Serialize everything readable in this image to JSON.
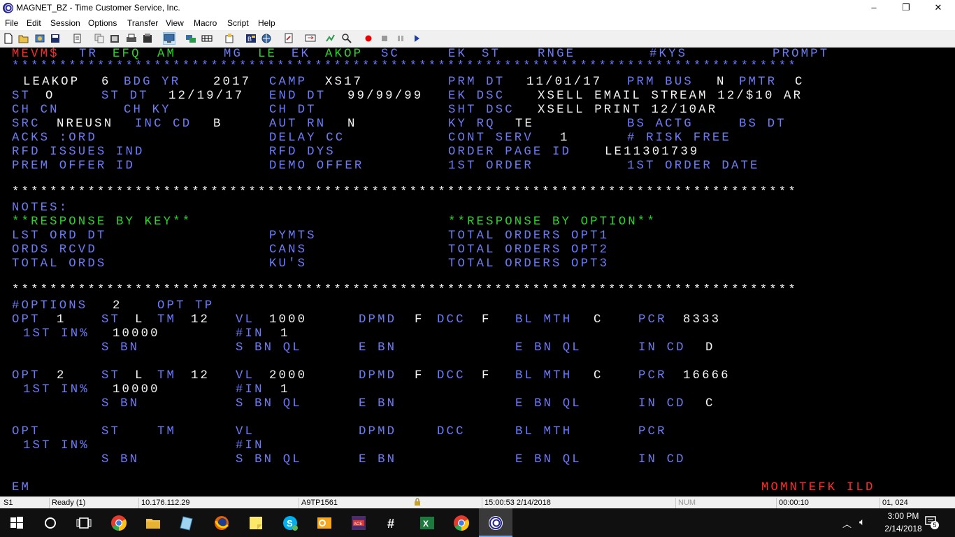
{
  "window": {
    "title": "MAGNET_BZ - Time Customer Service, Inc.",
    "minimize": "–",
    "maximize": "❐",
    "close": "✕"
  },
  "menu": [
    "File",
    "Edit",
    "Session",
    "Options",
    "Transfer",
    "View",
    "Macro",
    "Script",
    "Help"
  ],
  "toolbar_icons": [
    "new-icon",
    "open-icon",
    "properties-icon",
    "save-icon",
    "print-icon",
    "copy-icon",
    "paste-icon",
    "print-screen-icon",
    "clipboard-icon",
    "display-icon",
    "session-icon",
    "keyboard-icon",
    "keymap-icon",
    "font-icon",
    "globe-icon",
    "edit-icon",
    "transfer-icon",
    "macro-icon",
    "find-icon",
    "record-icon",
    "stop-icon",
    "pause-icon",
    "play-icon"
  ],
  "terminal": {
    "row0": {
      "screen_id": "MEVM$",
      "tr": "TR",
      "efq": "EFQ",
      "am": "AM",
      "mg": "MG",
      "le": "LE",
      "ek": "EK",
      "akop": "AKOP",
      "sc": "SC",
      "ek2": "EK",
      "st": "ST",
      "rnge": "RNGE",
      "kys": "#KYS",
      "prompt": "PROMPT"
    },
    "stars": "***********************************************************************************",
    "header": {
      "code": "LEAKOP",
      "num": "6",
      "bdg_yr_label": "BDG YR",
      "bdg_yr": "2017",
      "camp_label": "CAMP",
      "camp": "XS17",
      "prm_dt_label": "PRM DT",
      "prm_dt": "11/01/17",
      "prm_bus_label": "PRM BUS",
      "prm_bus": "N",
      "pmtr_label": "PMTR",
      "pmtr": "C",
      "st_label": "ST",
      "st": "O",
      "st_dt_label": "ST DT",
      "st_dt": "12/19/17",
      "end_dt_label": "END DT",
      "end_dt": "99/99/99",
      "ek_dsc_label": "EK DSC",
      "ek_dsc": "XSELL EMAIL STREAM 12/$10 AR",
      "ch_cn_label": "CH CN",
      "ch_ky_label": "CH KY",
      "ch_dt_label": "CH DT",
      "sht_dsc_label": "SHT DSC",
      "sht_dsc": "XSELL PRINT 12/10AR",
      "src_label": "SRC",
      "src": "NREUSN",
      "inc_cd_label": "INC CD",
      "inc_cd": "B",
      "aut_rn_label": "AUT RN",
      "aut_rn": "N",
      "ky_rq_label": "KY RQ",
      "ky_rq": "TE",
      "bs_actg_label": "BS ACTG",
      "bs_dt_label": "BS DT",
      "acks_label": "ACKS :ORD",
      "delay_cc_label": "DELAY CC",
      "cont_serv_label": "CONT SERV",
      "cont_serv": "1",
      "risk_free_label": "# RISK FREE",
      "rfd_issues_label": "RFD ISSUES IND",
      "rfd_dys_label": "RFD DYS",
      "order_page_id_label": "ORDER PAGE ID",
      "order_page_id": "LE11301739",
      "prem_offer_label": "PREM OFFER ID",
      "demo_offer_label": "DEMO OFFER",
      "first_order_label": "1ST ORDER",
      "first_order_date_label": "1ST ORDER DATE"
    },
    "notes": {
      "label": "NOTES:",
      "resp_key": "**RESPONSE BY KEY**",
      "resp_opt": "**RESPONSE BY OPTION**",
      "lst_ord_dt": "LST ORD DT",
      "pymts": "PYMTS",
      "total_opt1": "TOTAL ORDERS OPT1",
      "ords_rcvd": "ORDS RCVD",
      "cans": "CANS",
      "total_opt2": "TOTAL ORDERS OPT2",
      "total_ords": "TOTAL ORDS",
      "kus": "KU'S",
      "total_opt3": "TOTAL ORDERS OPT3"
    },
    "options": {
      "count_label": "#OPTIONS",
      "count": "2",
      "opt_tp_label": "OPT TP",
      "items": [
        {
          "opt": "1",
          "st": "L",
          "tm": "12",
          "vl": "1000",
          "dpmd": "F",
          "dcc": "F",
          "bl_mth": "C",
          "pcr": "8333",
          "first_in": "10000",
          "num_in": "1",
          "in_cd": "D"
        },
        {
          "opt": "2",
          "st": "L",
          "tm": "12",
          "vl": "2000",
          "dpmd": "F",
          "dcc": "F",
          "bl_mth": "C",
          "pcr": "16666",
          "first_in": "10000",
          "num_in": "1",
          "in_cd": "C"
        }
      ],
      "labels": {
        "opt": "OPT",
        "st": "ST",
        "tm": "TM",
        "vl": "VL",
        "dpmd": "DPMD",
        "dcc": "DCC",
        "bl_mth": "BL MTH",
        "pcr": "PCR",
        "first_in": "1ST IN%",
        "num_in": "#IN",
        "s_bn": "S BN",
        "s_bn_ql": "S BN QL",
        "e_bn": "E BN",
        "e_bn_ql": "E BN QL",
        "in_cd": "IN CD"
      }
    },
    "footer": {
      "em": "EM",
      "right": "MOMNTEFK ILD"
    }
  },
  "statusbar": {
    "session": "S1",
    "state": "Ready (1)",
    "ip": "10.176.112.29",
    "lu": "A9TP1561",
    "datetime": "15:00:53  2/14/2018",
    "num": "NUM",
    "elapsed": "00:00:10",
    "cursor": "01, 024"
  },
  "taskbar": {
    "time": "3:00 PM",
    "date": "2/14/2018",
    "notifications": "5",
    "apps": [
      "chrome-icon",
      "file-explorer-icon",
      "notepad-icon",
      "firefox-icon",
      "sticky-notes-icon",
      "skype-icon",
      "outlook-icon",
      "poker-icon",
      "slack-icon",
      "excel-icon",
      "chrome-icon",
      "magnet-icon"
    ]
  }
}
